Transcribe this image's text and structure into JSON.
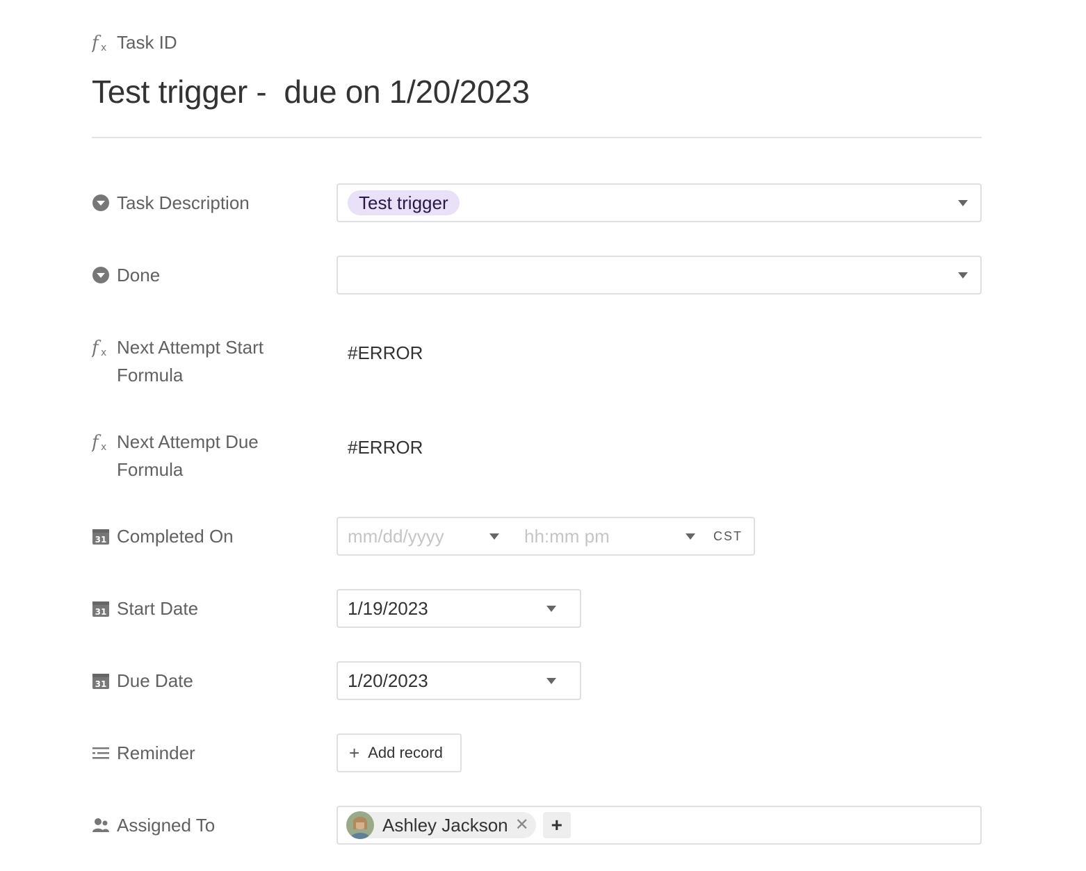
{
  "header": {
    "primary_field_label": "Task ID",
    "title": "Test trigger -  due on 1/20/2023"
  },
  "fields": {
    "task_description": {
      "label": "Task Description",
      "value": "Test trigger",
      "tag_color": "#e9e1f7"
    },
    "done": {
      "label": "Done",
      "value": ""
    },
    "next_attempt_start": {
      "label_line1": "Next Attempt Start",
      "label_line2": "Formula",
      "value": "#ERROR"
    },
    "next_attempt_due": {
      "label_line1": "Next Attempt Due",
      "label_line2": "Formula",
      "value": "#ERROR"
    },
    "completed_on": {
      "label": "Completed On",
      "date_placeholder": "mm/dd/yyyy",
      "time_placeholder": "hh:mm pm",
      "timezone": "CST"
    },
    "start_date": {
      "label": "Start Date",
      "value": "1/19/2023"
    },
    "due_date": {
      "label": "Due Date",
      "value": "1/20/2023"
    },
    "reminder": {
      "label": "Reminder",
      "button_label": "Add record"
    },
    "assigned_to": {
      "label": "Assigned To",
      "collaborator": "Ashley Jackson"
    }
  },
  "icons": {
    "formula": "fx-icon",
    "single_select": "caret-circle-icon",
    "date": "calendar-icon",
    "linked_record": "list-icon",
    "user": "users-icon"
  }
}
